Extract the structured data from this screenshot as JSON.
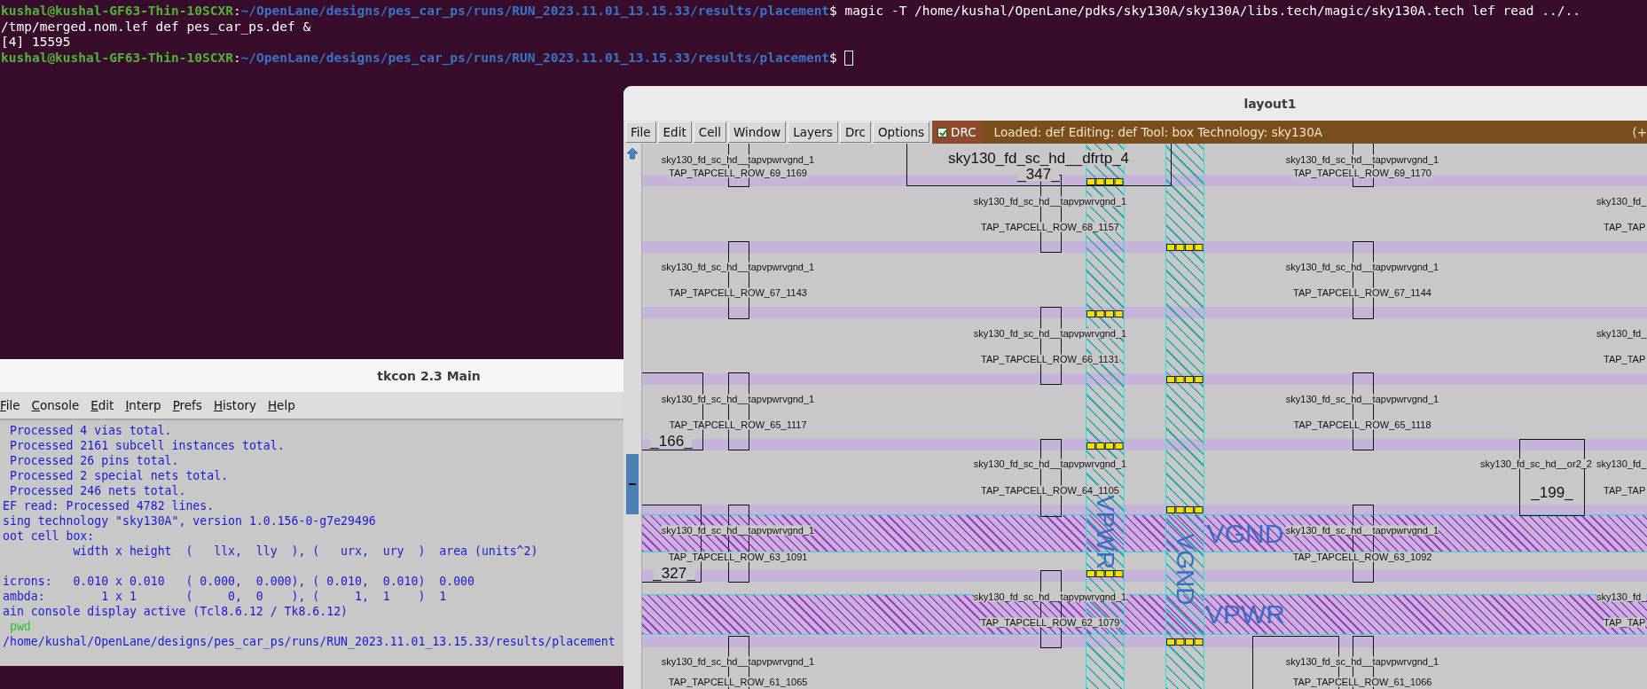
{
  "terminal": {
    "lines": [
      {
        "kind": "prompt",
        "user": "kushal@kushal-GF63-Thin-10SCXR",
        "colon": ":",
        "path": "~/OpenLane/designs/pes_car_ps/runs/RUN_2023.11.01_13.15.33/results/placement",
        "dollar": "$",
        "command": "magic -T /home/kushal/OpenLane/pdks/sky130A/sky130A/libs.tech/magic/sky130A.tech lef read ../.."
      },
      {
        "kind": "output",
        "text": "/tmp/merged.nom.lef def pes_car_ps.def &"
      },
      {
        "kind": "output",
        "text": "[4] 15595"
      },
      {
        "kind": "prompt",
        "user": "kushal@kushal-GF63-Thin-10SCXR",
        "colon": ":",
        "path": "~/OpenLane/designs/pes_car_ps/runs/RUN_2023.11.01_13.15.33/results/placement",
        "dollar": "$",
        "cursor": true
      }
    ]
  },
  "tkcon": {
    "title": "tkcon 2.3 Main",
    "menu": [
      "File",
      "Console",
      "Edit",
      "Interp",
      "Prefs",
      "History",
      "Help"
    ],
    "lines": [
      {
        "kind": "output",
        "text": " Processed 4 vias total."
      },
      {
        "kind": "output",
        "text": " Processed 2161 subcell instances total."
      },
      {
        "kind": "output",
        "text": " Processed 26 pins total."
      },
      {
        "kind": "output",
        "text": " Processed 2 special nets total."
      },
      {
        "kind": "output",
        "text": " Processed 246 nets total."
      },
      {
        "kind": "output",
        "text": "EF read: Processed 4782 lines."
      },
      {
        "kind": "output",
        "text": "sing technology \"sky130A\", version 1.0.156-0-g7e29496"
      },
      {
        "kind": "output",
        "text": "oot cell box:"
      },
      {
        "kind": "output",
        "text": "          width x height  (   llx,  lly  ), (   urx,  ury  )  area (units^2)"
      },
      {
        "kind": "blank"
      },
      {
        "kind": "output",
        "text": "icrons:   0.010 x 0.010   ( 0.000,  0.000), ( 0.010,  0.010)  0.000"
      },
      {
        "kind": "output",
        "text": "ambda:        1 x 1       (     0,  0    ), (     1,  1    )  1"
      },
      {
        "kind": "output",
        "text": "ain console display active (Tcl8.6.12 / Tk8.6.12)"
      },
      {
        "kind": "command",
        "text": " pwd"
      },
      {
        "kind": "output",
        "text": "/home/kushal/OpenLane/designs/pes_car_ps/runs/RUN_2023.11.01_13.15.33/results/placement"
      }
    ]
  },
  "layout_window": {
    "title": "layout1",
    "menu": [
      "File",
      "Edit",
      "Cell",
      "Window",
      "Layers",
      "Drc",
      "Options"
    ],
    "drc": {
      "label": "DRC",
      "checked": true
    },
    "status": "Loaded: def Editing: def Tool: box  Technology: sky130A",
    "status_right": "(+",
    "canvas": {
      "cell_labels": [
        "sky130_fd_sc_hd__tapvpwrvgnd_1",
        "TAP_TAPCELL_ROW_69_1169",
        "sky130_fd_sc_hd__tapvpwrvgnd_1",
        "TAP_TAPCELL_ROW_69_1170",
        "sky130_fd_sc_hd__dfrtp_4",
        "_347_",
        "sky130_fd_sc_hd__tapvpwrvgnd_1",
        "TAP_TAPCELL_ROW_68_1157",
        "sky130_fd_",
        "TAP_TAP",
        "sky130_fd_sc_hd__tapvpwrvgnd_1",
        "TAP_TAPCELL_ROW_67_1143",
        "sky130_fd_sc_hd__tapvpwrvgnd_1",
        "TAP_TAPCELL_ROW_67_1144",
        "sky130_fd_sc_hd__tapvpwrvgnd_1",
        "TAP_TAPCELL_ROW_66_1131",
        "sky130_fd_",
        "TAP_TAP",
        "sky130_fd_sc_hd__tapvpwrvgnd_1",
        "TAP_TAPCELL_ROW_65_1117",
        "_166_",
        "sky130_fd_sc_hd__tapvpwrvgnd_1",
        "TAP_TAPCELL_ROW_65_1118",
        "sky130_fd_sc_hd__tapvpwrvgnd_1",
        "TAP_TAPCELL_ROW_64_1105",
        "sky130_fd_sc_hd__or2_2",
        "_199_",
        "sky130_fd_",
        "TAP_TAP",
        "sky130_fd_sc_hd__tapvpwrvgnd_1",
        "TAP_TAPCELL_ROW_63_1091",
        "_327_",
        "sky130_fd_sc_hd__tapvpwrvgnd_1",
        "TAP_TAPCELL_ROW_63_1092",
        "sky130_fd_sc_hd__tapvpwrvgnd_1",
        "TAP_TAPCELL_ROW_62_1079",
        "sky130_fd_",
        "TAP_TAP",
        "sky130_fd_sc_hd__tapvpwrvgnd_1",
        "TAP_TAPCELL_ROW_61_1065",
        "sky130_fd_sc_hd__tapvpwrvgnd_1",
        "TAP_TAPCELL_ROW_61_1066"
      ],
      "net_labels": [
        {
          "text": "VPWR",
          "kind": "vertical"
        },
        {
          "text": "VGND",
          "kind": "vertical"
        },
        {
          "text": "VGND",
          "kind": "horizontal"
        },
        {
          "text": "VPWR",
          "kind": "horizontal"
        }
      ]
    }
  }
}
